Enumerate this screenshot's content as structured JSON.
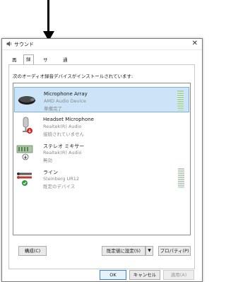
{
  "window": {
    "title": "サウンド",
    "close_glyph": "✕"
  },
  "tabs": [
    {
      "label": "再生",
      "active": false
    },
    {
      "label": "録音",
      "active": true
    },
    {
      "label": "サウンド",
      "active": false
    },
    {
      "label": "通信",
      "active": false
    }
  ],
  "intro_text": "次のオーディオ録音デバイスがインストールされています:",
  "devices": [
    {
      "name": "Microphone Array",
      "driver": "AMD Audio Device",
      "status": "準備完了",
      "icon": "microphone-array-icon",
      "selected": true
    },
    {
      "name": "Headset Microphone",
      "driver": "Realtek(R) Audio",
      "status": "接続されていません",
      "icon": "headset-microphone-icon",
      "selected": false
    },
    {
      "name": "ステレオ ミキサー",
      "driver": "Realtek(R) Audio",
      "status": "無効",
      "icon": "stereo-mixer-icon",
      "selected": false
    },
    {
      "name": "ライン",
      "driver": "Steinberg UR12",
      "status": "既定のデバイス",
      "icon": "line-in-icon",
      "selected": false
    }
  ],
  "buttons": {
    "configure": "構成(C)",
    "set_default": "既定値に設定(S)",
    "set_default_arrow": "▼",
    "properties": "プロパティ(P)",
    "ok": "OK",
    "cancel": "キャンセル",
    "apply": "適用(A)"
  },
  "colors": {
    "selection": "#cce4f7",
    "selection_border": "#7db3e2",
    "meter": "#9cd4a0",
    "default_badge": "#2e9b3c",
    "disconnected_badge": "#d62020"
  }
}
